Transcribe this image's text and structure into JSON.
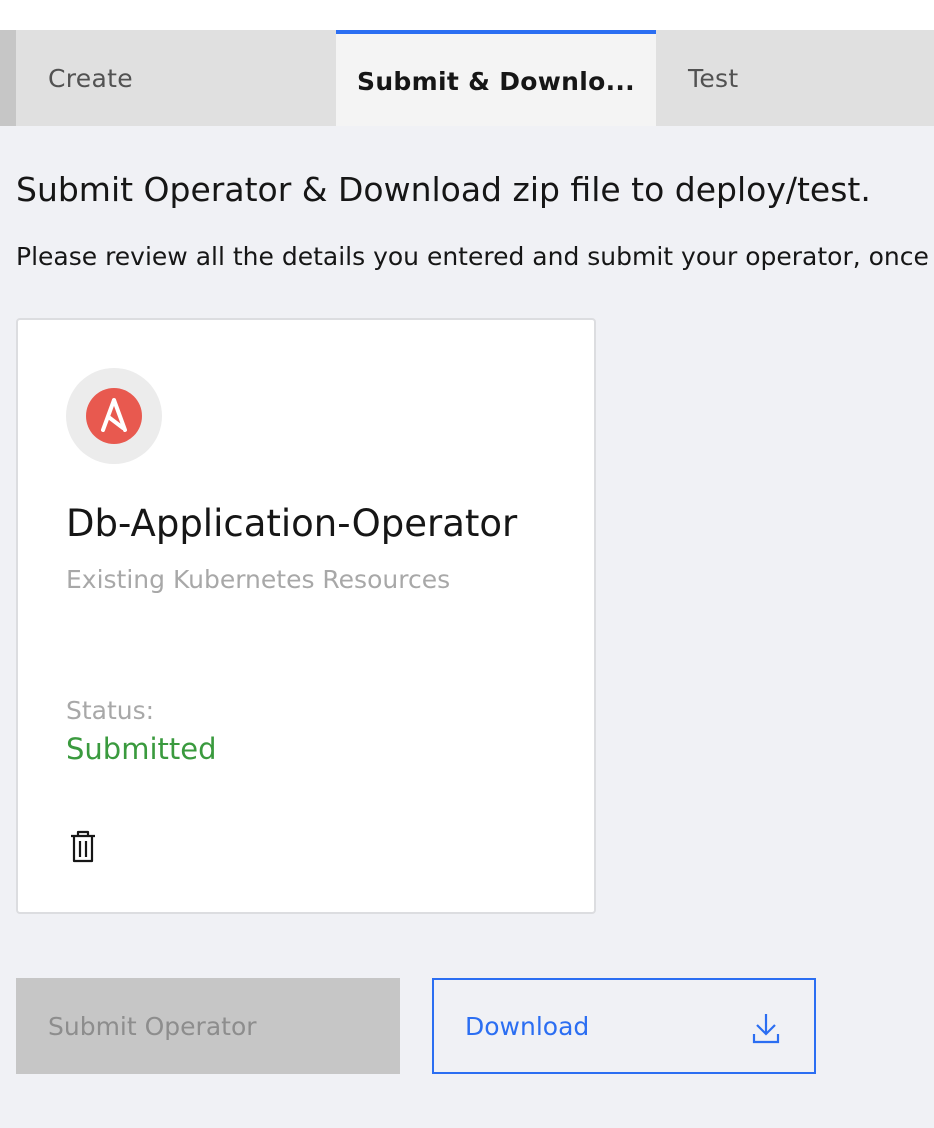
{
  "tabs": {
    "create": "Create",
    "submit": "Submit & Downlo...",
    "test": "Test",
    "active": "submit"
  },
  "page": {
    "heading": "Submit Operator & Download zip file to deploy/test.",
    "description": "Please review all the details you entered and submit your operator, once"
  },
  "card": {
    "logo_icon": "ansible-logo-icon",
    "title": "Db-Application-Operator",
    "subtitle": "Existing Kubernetes Resources",
    "status_label": "Status:",
    "status_value": "Submitted",
    "delete_icon": "trash-icon"
  },
  "actions": {
    "submit_label": "Submit Operator",
    "download_label": "Download",
    "download_icon": "download-icon"
  },
  "colors": {
    "accent": "#2b6ef2",
    "status_success": "#3a9a3e",
    "logo": "#e8594f"
  }
}
